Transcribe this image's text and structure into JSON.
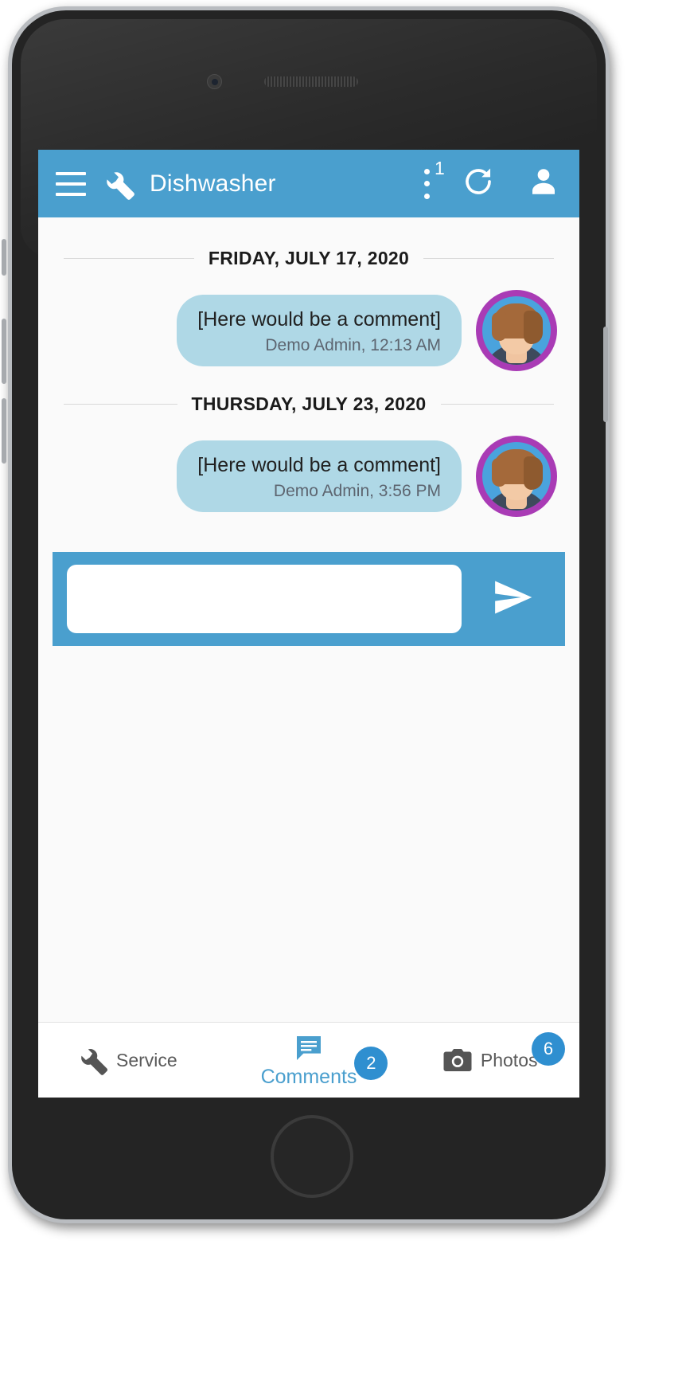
{
  "device": {
    "name": "smartphone-mockup",
    "speaker": "earpiece-speaker",
    "camera": "front-camera",
    "home_button": "home-button"
  },
  "appbar": {
    "menu_icon": "hamburger-menu-icon",
    "title_icon": "wrench-icon",
    "title": "Dishwasher",
    "overflow_icon": "kebab-menu-icon",
    "overflow_badge": "1",
    "refresh_icon": "refresh-icon",
    "account_icon": "person-icon",
    "background_color": "#4a9fce"
  },
  "conversation": {
    "groups": [
      {
        "date_label": "FRIDAY, JULY 17, 2020",
        "messages": [
          {
            "text": "[Here would be a comment]",
            "meta": "Demo Admin, 12:13 AM",
            "author": "Demo Admin",
            "time": "12:13 AM",
            "avatar": "user-avatar"
          }
        ]
      },
      {
        "date_label": "THURSDAY, JULY 23, 2020",
        "messages": [
          {
            "text": "[Here would be a comment]",
            "meta": "Demo Admin, 3:56 PM",
            "author": "Demo Admin",
            "time": "3:56 PM",
            "avatar": "user-avatar"
          }
        ]
      }
    ],
    "bubble_color": "#afd8e6"
  },
  "composer": {
    "value": "",
    "placeholder": "",
    "send_icon": "send-icon",
    "background_color": "#4a9fce"
  },
  "tabbar": {
    "tabs": [
      {
        "label": "Service",
        "icon": "wrench-icon",
        "badge": "",
        "active": false
      },
      {
        "label": "Comments",
        "icon": "comment-icon",
        "badge": "2",
        "active": true
      },
      {
        "label": "Photos",
        "icon": "camera-icon",
        "badge": "6",
        "active": false
      }
    ],
    "accent_color": "#4a9fce",
    "badge_color": "#2f8fd0"
  }
}
